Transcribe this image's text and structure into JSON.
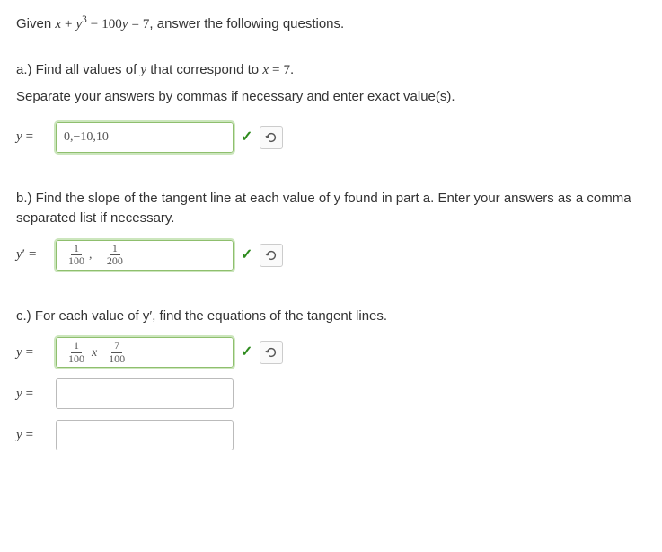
{
  "intro": {
    "given_pre": "Given ",
    "eq": "x + y³ − 100y = 7",
    "given_post": ", answer the following questions."
  },
  "a": {
    "prompt_pre": "a.) Find all values of ",
    "var": "y",
    "prompt_mid": " that correspond to ",
    "xexpr": "x = 7",
    "prompt_end": ".",
    "note": "Separate your answers by commas if necessary and enter exact value(s).",
    "label": "y =",
    "answer": "0,−10,10",
    "correct": true
  },
  "b": {
    "prompt": "b.) Find the slope of the tangent line at each value of y found in part a. Enter your answers as a comma separated list if necessary.",
    "label": "y′ =",
    "answer_parts": {
      "f1n": "1",
      "f1d": "100",
      "sep": ", −",
      "f2n": "1",
      "f2d": "200"
    },
    "correct": true
  },
  "c": {
    "prompt": "c.) For each value of y′, find the equations of the tangent lines.",
    "label": "y =",
    "line1_parts": {
      "f1n": "1",
      "f1d": "100",
      "xvar": "x",
      "minus": " − ",
      "f2n": "7",
      "f2d": "100"
    },
    "line1_correct": true,
    "line2": "",
    "line3": ""
  },
  "icons": {
    "check": "✓"
  }
}
